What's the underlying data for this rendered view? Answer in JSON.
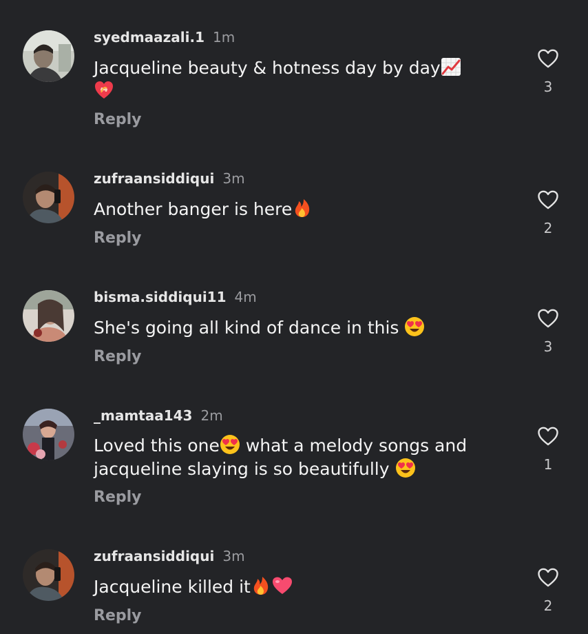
{
  "comments": [
    {
      "username": "syedmaazali.1",
      "time": "1m",
      "text": "Jacqueline beauty & hotness day by day",
      "emojis": [
        "chart-increasing-emoji",
        "mending-heart-emoji"
      ],
      "reply_label": "Reply",
      "likes": "3"
    },
    {
      "username": "zufraansiddiqui",
      "time": "3m",
      "text": "Another banger is here",
      "emojis": [
        "fire-emoji"
      ],
      "reply_label": "Reply",
      "likes": "2"
    },
    {
      "username": "bisma.siddiqui11",
      "time": "4m",
      "text": "She's going all kind of dance in this",
      "emojis": [
        "heart-eyes-emoji"
      ],
      "reply_label": "Reply",
      "likes": "3"
    },
    {
      "username": "_mamtaa143",
      "time": "2m",
      "text_part1": "Loved this one",
      "text_part2": "what a melody songs and",
      "text_part3": "jacqueline slaying is so beautifully",
      "emojis": [
        "heart-eyes-emoji",
        "heart-eyes-emoji"
      ],
      "reply_label": "Reply",
      "likes": "1"
    },
    {
      "username": "zufraansiddiqui",
      "time": "3m",
      "text": "Jacqueline killed it",
      "emojis": [
        "fire-emoji",
        "pink-heart-emoji"
      ],
      "reply_label": "Reply",
      "likes": "2"
    }
  ],
  "icons": {
    "like": "heart-outline-icon"
  },
  "colors": {
    "background": "#232427",
    "username": "#e6e6e6",
    "secondary_text": "#9b9ca0"
  }
}
